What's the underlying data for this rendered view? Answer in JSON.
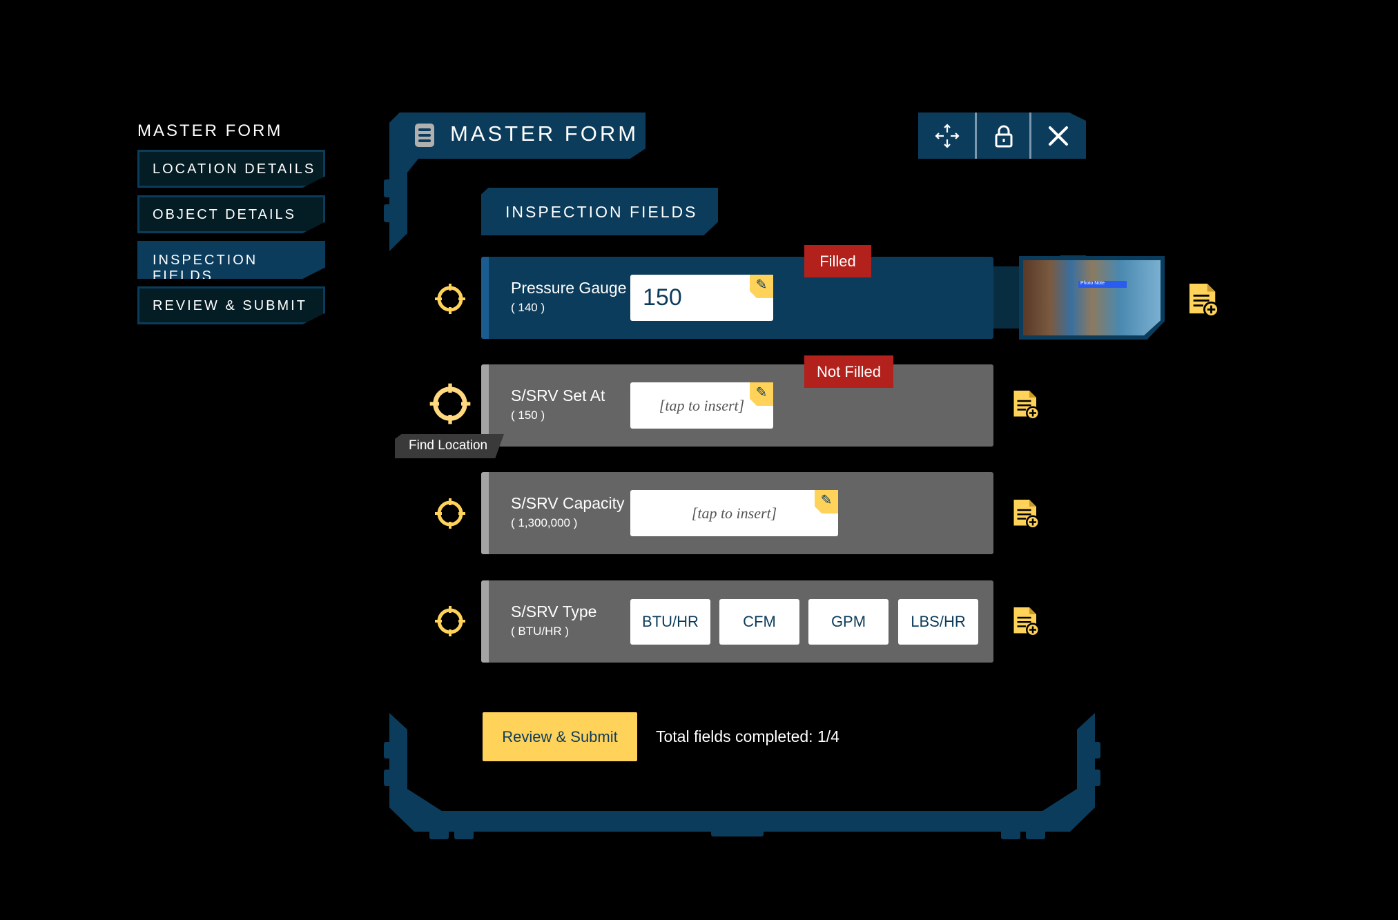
{
  "sidebar": {
    "title": "MASTER FORM",
    "items": [
      {
        "label": "LOCATION DETAILS"
      },
      {
        "label": "OBJECT DETAILS"
      },
      {
        "label": "INSPECTION FIELDS",
        "active": true
      },
      {
        "label": "REVIEW & SUBMIT"
      }
    ]
  },
  "header": {
    "title": "MASTER FORM"
  },
  "section": {
    "title": "INSPECTION FIELDS"
  },
  "fields": [
    {
      "label": "Pressure Gauge",
      "reference": "( 140 )",
      "value": "150",
      "status": "Filled"
    },
    {
      "label": "S/SRV Set At",
      "reference": "( 150 )",
      "placeholder": "[tap to insert]",
      "status": "Not Filled",
      "tooltip": "Find Location"
    },
    {
      "label": "S/SRV Capacity",
      "reference": "( 1,300,000 )",
      "placeholder": "[tap to insert]"
    },
    {
      "label": "S/SRV Type",
      "reference": "( BTU/HR )",
      "options": [
        "BTU/HR",
        "CFM",
        "GPM",
        "LBS/HR"
      ]
    }
  ],
  "photo": {
    "label": "Photo Note"
  },
  "footer": {
    "submit_label": "Review & Submit",
    "total_text": "Total fields completed: 1/4"
  },
  "colors": {
    "panel": "#0c3c5c",
    "accent": "#ffd25a",
    "row_gray": "#646564",
    "badge": "#b3211c"
  }
}
